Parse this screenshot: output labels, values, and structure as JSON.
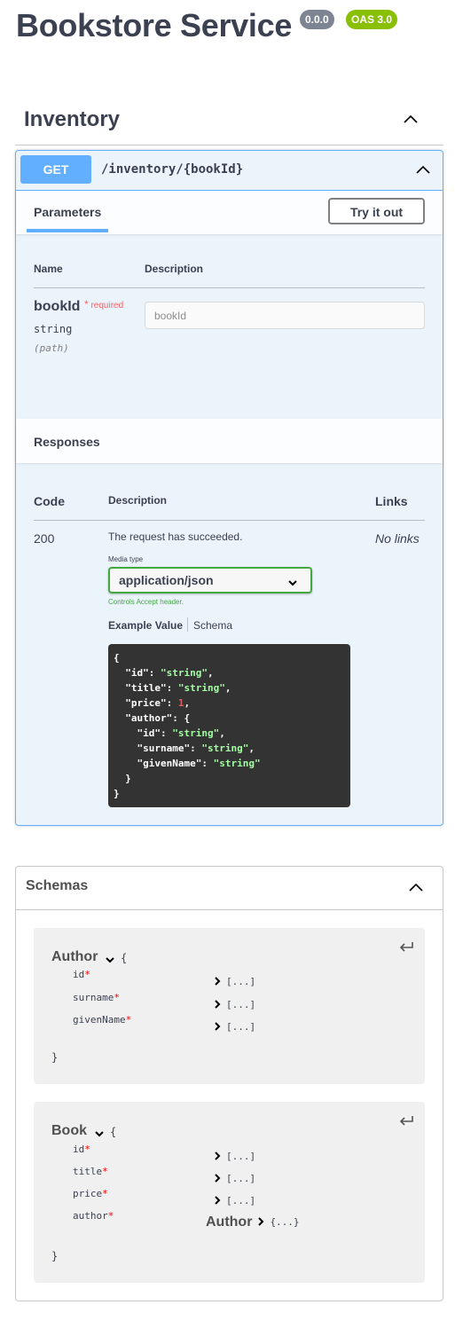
{
  "header": {
    "title": "Bookstore Service",
    "version_badge": "0.0.0",
    "oas_badge": "OAS 3.0"
  },
  "tag": {
    "title": "Inventory",
    "toggle_icon": "chevron-up-icon"
  },
  "operation": {
    "method": "GET",
    "path": "/inventory/{bookId}",
    "toggle_icon": "chevron-up-icon",
    "tabs": {
      "parameters": "Parameters"
    },
    "try_it_out_label": "Try it out",
    "parameters": {
      "headers": [
        "Name",
        "Description"
      ],
      "items": [
        {
          "name": "bookId",
          "required_marker": "*",
          "required_label": "required",
          "type": "string",
          "in": "(path)",
          "input_placeholder": "bookId",
          "input_value": ""
        }
      ]
    },
    "responses": {
      "title": "Responses",
      "headers": [
        "Code",
        "Description",
        "Links"
      ],
      "items": [
        {
          "code": "200",
          "description": "The request has succeeded.",
          "links": "No links",
          "media_type_label": "Media type",
          "media_type_value": "application/json",
          "media_type_note": "Controls Accept header.",
          "example_tabs": [
            "Example Value",
            "Schema"
          ],
          "example_active_tab": "Example Value",
          "example_lines": [
            [
              {
                "t": "p",
                "v": "{"
              }
            ],
            [
              {
                "t": "p",
                "v": "  \"id\": "
              },
              {
                "t": "s",
                "v": "\"string\""
              },
              {
                "t": "p",
                "v": ","
              }
            ],
            [
              {
                "t": "p",
                "v": "  \"title\": "
              },
              {
                "t": "s",
                "v": "\"string\""
              },
              {
                "t": "p",
                "v": ","
              }
            ],
            [
              {
                "t": "p",
                "v": "  \"price\": "
              },
              {
                "t": "n",
                "v": "1"
              },
              {
                "t": "p",
                "v": ","
              }
            ],
            [
              {
                "t": "p",
                "v": "  \"author\": {"
              }
            ],
            [
              {
                "t": "p",
                "v": "    \"id\": "
              },
              {
                "t": "s",
                "v": "\"string\""
              },
              {
                "t": "p",
                "v": ","
              }
            ],
            [
              {
                "t": "p",
                "v": "    \"surname\": "
              },
              {
                "t": "s",
                "v": "\"string\""
              },
              {
                "t": "p",
                "v": ","
              }
            ],
            [
              {
                "t": "p",
                "v": "    \"givenName\": "
              },
              {
                "t": "s",
                "v": "\"string\""
              }
            ],
            [
              {
                "t": "p",
                "v": "  }"
              }
            ],
            [
              {
                "t": "p",
                "v": "}"
              }
            ]
          ]
        }
      ]
    }
  },
  "schemas": {
    "title": "Schemas",
    "toggle_icon": "chevron-up-icon",
    "models": [
      {
        "name": "Author",
        "open_brace": "{",
        "close_brace": "}",
        "properties": [
          {
            "name": "id",
            "required": "*",
            "value": "[...]"
          },
          {
            "name": "surname",
            "required": "*",
            "value": "[...]"
          },
          {
            "name": "givenName",
            "required": "*",
            "value": "[...]"
          }
        ]
      },
      {
        "name": "Book",
        "open_brace": "{",
        "close_brace": "}",
        "properties": [
          {
            "name": "id",
            "required": "*",
            "value": "[...]"
          },
          {
            "name": "title",
            "required": "*",
            "value": "[...]"
          },
          {
            "name": "price",
            "required": "*",
            "value": "[...]"
          },
          {
            "name": "author",
            "required": "*",
            "ref": "Author",
            "value": "{...}"
          }
        ]
      }
    ]
  },
  "colors": {
    "get_method": "#61affe",
    "version_badge": "#7d8492",
    "oas_badge": "#89bf04",
    "required": "#ff6060",
    "media_select_border": "#41a940",
    "code_bg": "#333333",
    "code_string": "#a2fca2",
    "code_number": "#d36363"
  }
}
